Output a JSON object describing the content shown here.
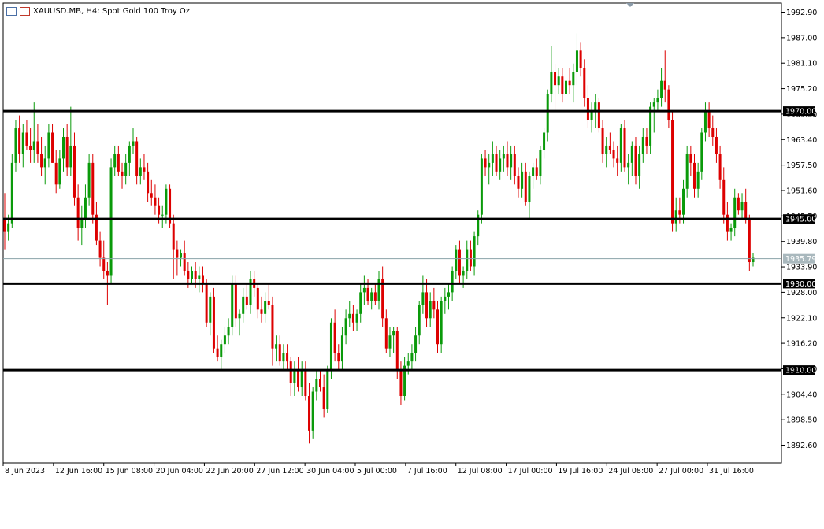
{
  "chart_title": {
    "symbol_line": "XAUUSD.MB, H4:  Spot Gold 100 Troy Oz"
  },
  "colors": {
    "bull": "#0a9a0a",
    "bear": "#dd0000",
    "grid": "#000000",
    "current_line": "#8aa2a8",
    "tag_fill": "#000000",
    "tag_text": "#ffffff",
    "current_tag_fill": "#a9b8bd"
  },
  "chart_data": {
    "type": "candlestick",
    "ylim": [
      1888.5,
      1995.0
    ],
    "y_ticks": [
      "1992.90",
      "1987.00",
      "1981.10",
      "1975.20",
      "1969.30",
      "1963.40",
      "1957.50",
      "1951.60",
      "1945.70",
      "1939.80",
      "1933.90",
      "1928.00",
      "1922.10",
      "1916.20",
      "1910.30",
      "1904.40",
      "1898.50",
      "1892.60"
    ],
    "x_labels": [
      "8 Jun 2023",
      "12 Jun 16:00",
      "15 Jun 08:00",
      "20 Jun 04:00",
      "22 Jun 20:00",
      "27 Jun 12:00",
      "30 Jun 04:00",
      "5 Jul 00:00",
      "7 Jul 16:00",
      "12 Jul 08:00",
      "17 Jul 00:00",
      "19 Jul 16:00",
      "24 Jul 08:00",
      "27 Jul 00:00",
      "31 Jul 16:00"
    ],
    "horizontal_levels": [
      {
        "value": 1970.0,
        "label": "1970.00"
      },
      {
        "value": 1945.0,
        "label": "1945.00"
      },
      {
        "value": 1930.0,
        "label": "1930.00"
      },
      {
        "value": 1910.0,
        "label": "1910.00"
      }
    ],
    "current_price": {
      "value": 1935.79,
      "label": "1935.79"
    },
    "candles": [
      [
        1945.0,
        1951.0,
        1938.0,
        1942.0
      ],
      [
        1942.0,
        1946.0,
        1940.0,
        1944.0
      ],
      [
        1944.0,
        1960.0,
        1943.0,
        1958.0
      ],
      [
        1958.0,
        1968.0,
        1956.0,
        1966.0
      ],
      [
        1966.0,
        1969.0,
        1958.0,
        1960.0
      ],
      [
        1960.0,
        1967.0,
        1957.0,
        1965.0
      ],
      [
        1965.0,
        1968.0,
        1961.0,
        1962.0
      ],
      [
        1962.0,
        1966.0,
        1958.0,
        1961.0
      ],
      [
        1961.0,
        1972.0,
        1958.0,
        1963.0
      ],
      [
        1963.0,
        1967.0,
        1958.0,
        1960.0
      ],
      [
        1960.0,
        1964.0,
        1955.0,
        1957.0
      ],
      [
        1957.0,
        1962.0,
        1953.0,
        1959.0
      ],
      [
        1959.0,
        1967.0,
        1957.0,
        1965.0
      ],
      [
        1965.0,
        1967.0,
        1958.0,
        1958.0
      ],
      [
        1958.0,
        1961.0,
        1951.0,
        1953.0
      ],
      [
        1953.0,
        1961.0,
        1952.0,
        1959.0
      ],
      [
        1959.0,
        1966.0,
        1956.0,
        1964.0
      ],
      [
        1964.0,
        1967.0,
        1955.0,
        1957.0
      ],
      [
        1957.0,
        1971.0,
        1955.0,
        1962.0
      ],
      [
        1962.0,
        1965.0,
        1948.0,
        1950.0
      ],
      [
        1950.0,
        1953.0,
        1940.0,
        1943.0
      ],
      [
        1943.0,
        1948.0,
        1939.0,
        1945.0
      ],
      [
        1945.0,
        1953.0,
        1943.0,
        1950.0
      ],
      [
        1950.0,
        1960.0,
        1948.0,
        1958.0
      ],
      [
        1958.0,
        1960.0,
        1944.0,
        1946.0
      ],
      [
        1946.0,
        1949.0,
        1939.0,
        1940.0
      ],
      [
        1940.0,
        1942.0,
        1934.0,
        1936.0
      ],
      [
        1936.0,
        1940.0,
        1931.0,
        1933.0
      ],
      [
        1933.0,
        1935.0,
        1925.0,
        1932.0
      ],
      [
        1932.0,
        1959.0,
        1930.0,
        1957.0
      ],
      [
        1957.0,
        1962.0,
        1955.0,
        1960.0
      ],
      [
        1960.0,
        1962.0,
        1955.0,
        1956.0
      ],
      [
        1956.0,
        1958.0,
        1952.0,
        1955.0
      ],
      [
        1955.0,
        1960.0,
        1953.0,
        1958.0
      ],
      [
        1958.0,
        1963.0,
        1955.0,
        1962.0
      ],
      [
        1962.0,
        1966.0,
        1960.0,
        1963.0
      ],
      [
        1963.0,
        1964.0,
        1953.0,
        1955.0
      ],
      [
        1955.0,
        1959.0,
        1953.0,
        1957.0
      ],
      [
        1957.0,
        1960.0,
        1954.0,
        1956.0
      ],
      [
        1956.0,
        1958.0,
        1949.0,
        1951.0
      ],
      [
        1951.0,
        1954.0,
        1948.0,
        1950.0
      ],
      [
        1950.0,
        1953.0,
        1946.0,
        1948.0
      ],
      [
        1948.0,
        1950.0,
        1944.0,
        1946.0
      ],
      [
        1946.0,
        1948.0,
        1943.0,
        1946.0
      ],
      [
        1946.0,
        1953.0,
        1944.0,
        1952.0
      ],
      [
        1952.0,
        1953.0,
        1943.0,
        1944.0
      ],
      [
        1944.0,
        1946.0,
        1931.0,
        1938.0
      ],
      [
        1938.0,
        1940.0,
        1932.0,
        1936.0
      ],
      [
        1936.0,
        1938.0,
        1934.0,
        1937.0
      ],
      [
        1937.0,
        1940.0,
        1932.0,
        1933.0
      ],
      [
        1933.0,
        1935.0,
        1929.0,
        1931.0
      ],
      [
        1931.0,
        1934.0,
        1930.0,
        1933.0
      ],
      [
        1933.0,
        1935.0,
        1929.0,
        1931.0
      ],
      [
        1931.0,
        1934.0,
        1928.0,
        1932.0
      ],
      [
        1932.0,
        1934.0,
        1928.0,
        1930.0
      ],
      [
        1930.0,
        1931.0,
        1920.0,
        1921.0
      ],
      [
        1921.0,
        1928.0,
        1918.0,
        1927.0
      ],
      [
        1927.0,
        1929.0,
        1914.0,
        1915.0
      ],
      [
        1915.0,
        1918.0,
        1912.0,
        1913.0
      ],
      [
        1913.0,
        1917.0,
        1910.0,
        1916.0
      ],
      [
        1916.0,
        1920.0,
        1914.0,
        1918.0
      ],
      [
        1918.0,
        1922.0,
        1916.0,
        1920.0
      ],
      [
        1920.0,
        1932.0,
        1918.0,
        1930.0
      ],
      [
        1930.0,
        1932.0,
        1920.0,
        1922.0
      ],
      [
        1922.0,
        1924.0,
        1918.0,
        1923.0
      ],
      [
        1923.0,
        1929.0,
        1921.0,
        1927.0
      ],
      [
        1927.0,
        1930.0,
        1924.0,
        1925.0
      ],
      [
        1925.0,
        1933.0,
        1923.0,
        1931.0
      ],
      [
        1931.0,
        1933.0,
        1927.0,
        1929.0
      ],
      [
        1929.0,
        1930.0,
        1922.0,
        1924.0
      ],
      [
        1924.0,
        1927.0,
        1921.0,
        1923.0
      ],
      [
        1923.0,
        1928.0,
        1921.0,
        1926.0
      ],
      [
        1926.0,
        1930.0,
        1924.0,
        1925.0
      ],
      [
        1925.0,
        1927.0,
        1911.0,
        1915.0
      ],
      [
        1915.0,
        1918.0,
        1912.0,
        1916.0
      ],
      [
        1916.0,
        1918.0,
        1911.0,
        1912.0
      ],
      [
        1912.0,
        1916.0,
        1910.0,
        1914.0
      ],
      [
        1914.0,
        1916.0,
        1910.0,
        1912.0
      ],
      [
        1912.0,
        1913.0,
        1904.0,
        1907.0
      ],
      [
        1907.0,
        1912.0,
        1904.0,
        1910.0
      ],
      [
        1910.0,
        1913.0,
        1905.0,
        1906.0
      ],
      [
        1906.0,
        1912.0,
        1904.0,
        1910.0
      ],
      [
        1910.0,
        1912.0,
        1903.0,
        1904.0
      ],
      [
        1904.0,
        1907.0,
        1893.0,
        1896.0
      ],
      [
        1896.0,
        1906.0,
        1894.0,
        1905.0
      ],
      [
        1905.0,
        1910.0,
        1903.0,
        1908.0
      ],
      [
        1908.0,
        1910.0,
        1905.0,
        1906.0
      ],
      [
        1906.0,
        1909.0,
        1899.0,
        1901.0
      ],
      [
        1901.0,
        1911.0,
        1900.0,
        1910.0
      ],
      [
        1910.0,
        1922.0,
        1908.0,
        1921.0
      ],
      [
        1921.0,
        1924.0,
        1912.0,
        1914.0
      ],
      [
        1914.0,
        1916.0,
        1910.0,
        1912.0
      ],
      [
        1912.0,
        1920.0,
        1910.0,
        1918.0
      ],
      [
        1918.0,
        1924.0,
        1916.0,
        1922.0
      ],
      [
        1922.0,
        1926.0,
        1920.0,
        1923.0
      ],
      [
        1923.0,
        1925.0,
        1919.0,
        1921.0
      ],
      [
        1921.0,
        1924.0,
        1919.0,
        1923.0
      ],
      [
        1923.0,
        1930.0,
        1921.0,
        1928.0
      ],
      [
        1928.0,
        1932.0,
        1925.0,
        1929.0
      ],
      [
        1929.0,
        1931.0,
        1925.0,
        1926.0
      ],
      [
        1926.0,
        1929.0,
        1924.0,
        1928.0
      ],
      [
        1928.0,
        1930.0,
        1925.0,
        1926.0
      ],
      [
        1926.0,
        1933.0,
        1924.0,
        1931.0
      ],
      [
        1931.0,
        1934.0,
        1920.0,
        1922.0
      ],
      [
        1922.0,
        1924.0,
        1914.0,
        1915.0
      ],
      [
        1915.0,
        1920.0,
        1913.0,
        1918.0
      ],
      [
        1918.0,
        1920.0,
        1914.0,
        1919.0
      ],
      [
        1919.0,
        1920.0,
        1908.0,
        1910.0
      ],
      [
        1910.0,
        1912.0,
        1902.0,
        1904.0
      ],
      [
        1904.0,
        1913.0,
        1903.0,
        1911.0
      ],
      [
        1911.0,
        1914.0,
        1909.0,
        1912.0
      ],
      [
        1912.0,
        1916.0,
        1910.0,
        1914.0
      ],
      [
        1914.0,
        1920.0,
        1912.0,
        1918.0
      ],
      [
        1918.0,
        1926.0,
        1916.0,
        1925.0
      ],
      [
        1925.0,
        1932.0,
        1923.0,
        1928.0
      ],
      [
        1928.0,
        1931.0,
        1920.0,
        1922.0
      ],
      [
        1922.0,
        1928.0,
        1920.0,
        1926.0
      ],
      [
        1926.0,
        1929.0,
        1922.0,
        1924.0
      ],
      [
        1924.0,
        1926.0,
        1914.0,
        1916.0
      ],
      [
        1916.0,
        1927.0,
        1914.0,
        1926.0
      ],
      [
        1926.0,
        1929.0,
        1923.0,
        1927.0
      ],
      [
        1927.0,
        1930.0,
        1924.0,
        1928.0
      ],
      [
        1928.0,
        1934.0,
        1926.0,
        1933.0
      ],
      [
        1933.0,
        1939.0,
        1931.0,
        1938.0
      ],
      [
        1938.0,
        1940.0,
        1930.0,
        1932.0
      ],
      [
        1932.0,
        1934.0,
        1929.0,
        1933.0
      ],
      [
        1933.0,
        1940.0,
        1931.0,
        1938.0
      ],
      [
        1938.0,
        1940.0,
        1933.0,
        1934.0
      ],
      [
        1934.0,
        1942.0,
        1932.0,
        1941.0
      ],
      [
        1941.0,
        1947.0,
        1939.0,
        1946.0
      ],
      [
        1946.0,
        1960.0,
        1944.0,
        1959.0
      ],
      [
        1959.0,
        1961.0,
        1955.0,
        1957.0
      ],
      [
        1957.0,
        1960.0,
        1953.0,
        1958.0
      ],
      [
        1958.0,
        1963.0,
        1955.0,
        1960.0
      ],
      [
        1960.0,
        1962.0,
        1955.0,
        1956.0
      ],
      [
        1956.0,
        1961.0,
        1954.0,
        1959.0
      ],
      [
        1959.0,
        1962.0,
        1956.0,
        1960.0
      ],
      [
        1960.0,
        1963.0,
        1955.0,
        1957.0
      ],
      [
        1957.0,
        1962.0,
        1954.0,
        1960.0
      ],
      [
        1960.0,
        1962.0,
        1953.0,
        1955.0
      ],
      [
        1955.0,
        1957.0,
        1950.0,
        1952.0
      ],
      [
        1952.0,
        1958.0,
        1950.0,
        1956.0
      ],
      [
        1956.0,
        1958.0,
        1948.0,
        1949.0
      ],
      [
        1949.0,
        1956.0,
        1945.0,
        1955.0
      ],
      [
        1955.0,
        1958.0,
        1952.0,
        1957.0
      ],
      [
        1957.0,
        1959.0,
        1954.0,
        1955.0
      ],
      [
        1955.0,
        1962.0,
        1953.0,
        1961.0
      ],
      [
        1961.0,
        1966.0,
        1959.0,
        1965.0
      ],
      [
        1965.0,
        1975.0,
        1963.0,
        1974.0
      ],
      [
        1974.0,
        1985.0,
        1972.0,
        1979.0
      ],
      [
        1979.0,
        1981.0,
        1970.0,
        1976.0
      ],
      [
        1976.0,
        1980.0,
        1974.0,
        1978.0
      ],
      [
        1978.0,
        1980.0,
        1972.0,
        1974.0
      ],
      [
        1974.0,
        1978.0,
        1970.0,
        1977.0
      ],
      [
        1977.0,
        1980.0,
        1974.0,
        1976.0
      ],
      [
        1976.0,
        1981.0,
        1972.0,
        1979.0
      ],
      [
        1979.0,
        1988.0,
        1976.0,
        1984.0
      ],
      [
        1984.0,
        1986.0,
        1978.0,
        1980.0
      ],
      [
        1980.0,
        1982.0,
        1971.0,
        1973.0
      ],
      [
        1973.0,
        1976.0,
        1966.0,
        1968.0
      ],
      [
        1968.0,
        1972.0,
        1965.0,
        1970.0
      ],
      [
        1970.0,
        1974.0,
        1966.0,
        1972.0
      ],
      [
        1972.0,
        1973.0,
        1965.0,
        1966.0
      ],
      [
        1966.0,
        1968.0,
        1958.0,
        1960.0
      ],
      [
        1960.0,
        1964.0,
        1957.0,
        1962.0
      ],
      [
        1962.0,
        1965.0,
        1960.0,
        1961.0
      ],
      [
        1961.0,
        1963.0,
        1957.0,
        1959.0
      ],
      [
        1959.0,
        1962.0,
        1955.0,
        1958.0
      ],
      [
        1958.0,
        1967.0,
        1956.0,
        1966.0
      ],
      [
        1966.0,
        1968.0,
        1956.0,
        1957.0
      ],
      [
        1957.0,
        1960.0,
        1953.0,
        1958.0
      ],
      [
        1958.0,
        1963.0,
        1955.0,
        1962.0
      ],
      [
        1962.0,
        1964.0,
        1953.0,
        1955.0
      ],
      [
        1955.0,
        1962.0,
        1952.0,
        1960.0
      ],
      [
        1960.0,
        1966.0,
        1958.0,
        1964.0
      ],
      [
        1964.0,
        1966.0,
        1960.0,
        1962.0
      ],
      [
        1962.0,
        1972.0,
        1960.0,
        1971.0
      ],
      [
        1971.0,
        1973.0,
        1965.0,
        1972.0
      ],
      [
        1972.0,
        1975.0,
        1970.0,
        1973.0
      ],
      [
        1973.0,
        1980.0,
        1971.0,
        1977.0
      ],
      [
        1977.0,
        1984.0,
        1972.0,
        1975.0
      ],
      [
        1975.0,
        1976.0,
        1966.0,
        1968.0
      ],
      [
        1968.0,
        1970.0,
        1942.0,
        1944.0
      ],
      [
        1944.0,
        1950.0,
        1942.0,
        1947.0
      ],
      [
        1947.0,
        1950.0,
        1944.0,
        1946.0
      ],
      [
        1946.0,
        1954.0,
        1944.0,
        1952.0
      ],
      [
        1952.0,
        1962.0,
        1950.0,
        1960.0
      ],
      [
        1960.0,
        1962.0,
        1955.0,
        1958.0
      ],
      [
        1958.0,
        1960.0,
        1950.0,
        1952.0
      ],
      [
        1952.0,
        1958.0,
        1950.0,
        1956.0
      ],
      [
        1956.0,
        1966.0,
        1954.0,
        1965.0
      ],
      [
        1965.0,
        1972.0,
        1963.0,
        1970.0
      ],
      [
        1970.0,
        1972.0,
        1964.0,
        1966.0
      ],
      [
        1966.0,
        1969.0,
        1962.0,
        1964.0
      ],
      [
        1964.0,
        1966.0,
        1958.0,
        1960.0
      ],
      [
        1960.0,
        1962.0,
        1952.0,
        1954.0
      ],
      [
        1954.0,
        1957.0,
        1944.0,
        1946.0
      ],
      [
        1946.0,
        1949.0,
        1940.0,
        1942.0
      ],
      [
        1942.0,
        1944.0,
        1940.0,
        1943.0
      ],
      [
        1943.0,
        1952.0,
        1941.0,
        1950.0
      ],
      [
        1950.0,
        1951.0,
        1946.0,
        1947.0
      ],
      [
        1947.0,
        1951.0,
        1945.0,
        1949.0
      ],
      [
        1949.0,
        1952.0,
        1944.0,
        1945.0
      ],
      [
        1945.0,
        1946.0,
        1933.0,
        1935.0
      ],
      [
        1935.0,
        1937.0,
        1934.0,
        1936.0
      ]
    ]
  }
}
